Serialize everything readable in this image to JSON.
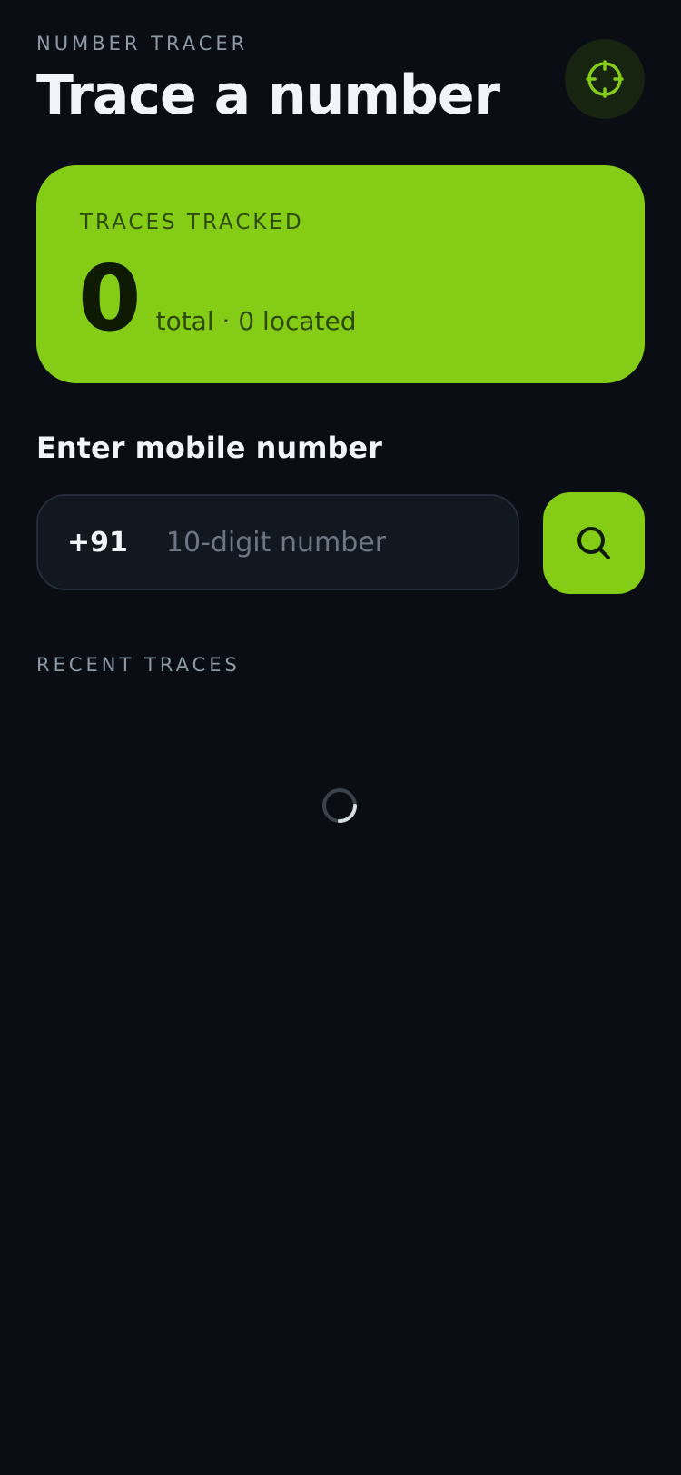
{
  "header": {
    "eyebrow": "NUMBER TRACER",
    "title": "Trace a number",
    "action_icon": "crosshair-icon"
  },
  "stats": {
    "label": "TRACES TRACKED",
    "count": "0",
    "subtitle": "total · 0 located"
  },
  "form": {
    "label": "Enter mobile number",
    "country_code": "+91",
    "placeholder": "10-digit number",
    "value": "",
    "search_icon": "search-icon"
  },
  "recent": {
    "label": "RECENT TRACES",
    "loading_icon": "loading-spinner-icon"
  },
  "colors": {
    "background": "#0a0d14",
    "accent": "#84cc16",
    "muted_text": "#8e9aa6",
    "input_bg": "#111820"
  }
}
